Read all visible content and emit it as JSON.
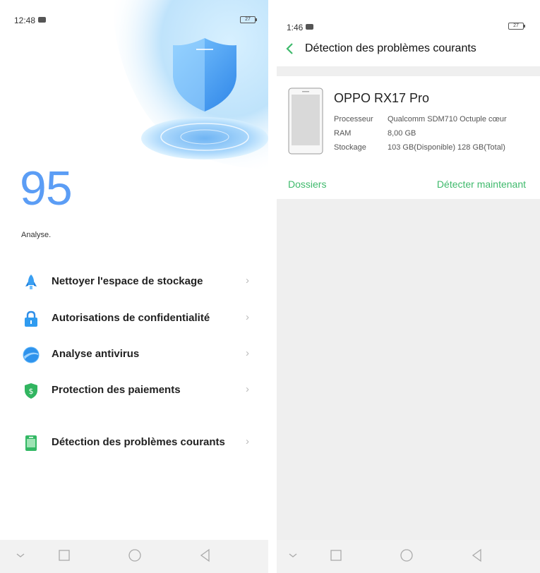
{
  "left": {
    "status": {
      "time": "12:48",
      "battery": "27"
    },
    "score": "95",
    "score_label": "Analyse.",
    "menu": [
      {
        "label": "Nettoyer l'espace de stockage",
        "icon": "rocket-icon"
      },
      {
        "label": "Autorisations de confidentialité",
        "icon": "lock-icon"
      },
      {
        "label": "Analyse antivirus",
        "icon": "antivirus-icon"
      },
      {
        "label": "Protection des paiements",
        "icon": "payment-shield-icon"
      },
      {
        "label": "Détection des problèmes courants",
        "icon": "phone-check-icon"
      }
    ],
    "chevron": "›"
  },
  "right": {
    "status": {
      "time": "1:46",
      "battery": "27"
    },
    "title": "Détection des problèmes courants",
    "device": {
      "name": "OPPO RX17 Pro",
      "specs": [
        {
          "key": "Processeur",
          "value": "Qualcomm SDM710 Octuple cœur"
        },
        {
          "key": "RAM",
          "value": "8,00 GB"
        },
        {
          "key": "Stockage",
          "value": "103 GB(Disponible) 128 GB(Total)"
        }
      ]
    },
    "folders_link": "Dossiers",
    "detect_link": "Détecter maintenant"
  },
  "colors": {
    "accent_green": "#3fba6c",
    "score_blue": "#5b9df5",
    "shield_blue": "#4a9ef0"
  }
}
